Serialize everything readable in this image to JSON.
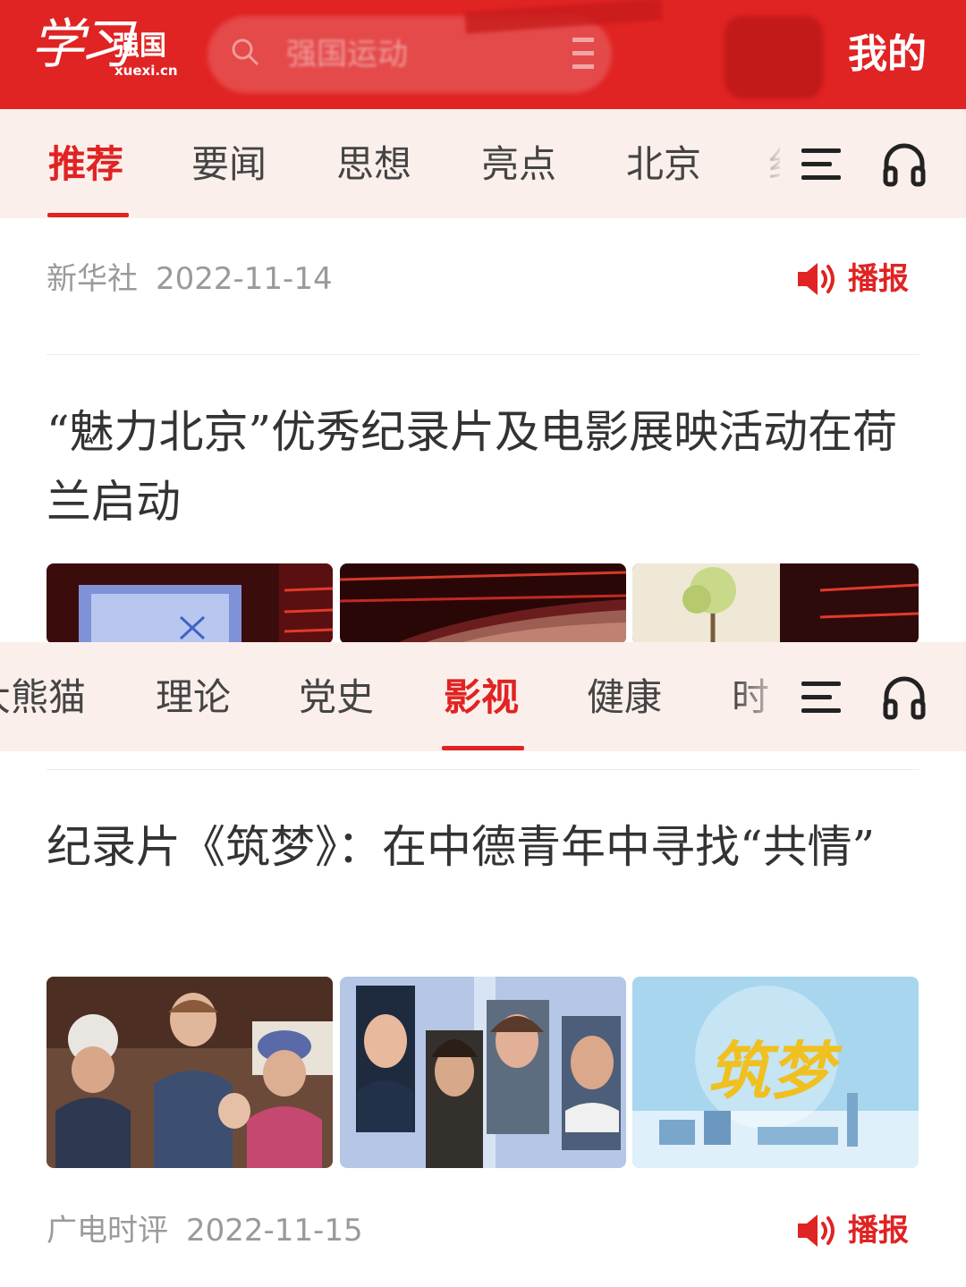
{
  "header": {
    "logo_script": "学习",
    "logo_name": "强国",
    "logo_domain": "xuexi.cn",
    "search_placeholder": "强国运动",
    "mine_label": "我的"
  },
  "tabs_top": {
    "items": [
      "推荐",
      "要闻",
      "思想",
      "亮点",
      "北京",
      "纟"
    ],
    "active_index": 0
  },
  "tabs_bottom": {
    "items": [
      "大熊猫",
      "理论",
      "党史",
      "影视",
      "健康",
      "时"
    ],
    "active_index": 3
  },
  "articles": [
    {
      "source": "新华社",
      "date": "2022-11-14",
      "play_label": "播报",
      "title": "“魅力北京”优秀纪录片及电影展映活动在荷兰启动"
    },
    {
      "title": "纪录片《筑梦》：在中德青年中寻找“共情”",
      "thumb_text": "筑梦",
      "source": "广电时评",
      "date": "2022-11-15",
      "play_label": "播报"
    }
  ],
  "colors": {
    "brand_red": "#e02323",
    "tab_bar_bg": "#fbefeb",
    "meta_gray": "#9a9a9a",
    "title_text": "#333333"
  }
}
